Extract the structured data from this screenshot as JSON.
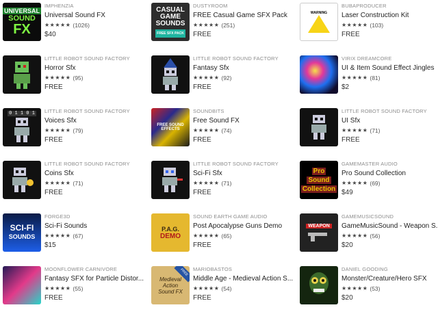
{
  "items": [
    {
      "publisher": "IMPHENZIA",
      "title": "Universal Sound FX",
      "stars": "★★★★★",
      "count": "(1026)",
      "price": "$40",
      "icon": "universal-sound-fx-icon"
    },
    {
      "publisher": "DUSTYROOM",
      "title": "FREE Casual Game SFX Pack",
      "stars": "★★★★★",
      "count": "(251)",
      "price": "FREE",
      "icon": "casual-game-sounds-icon"
    },
    {
      "publisher": "BUBAPRODUCER",
      "title": "Laser Construction Kit",
      "stars": "★★★★★",
      "count": "(103)",
      "price": "FREE",
      "icon": "laser-warning-icon"
    },
    {
      "publisher": "LITTLE ROBOT SOUND FACTORY",
      "title": "Horror Sfx",
      "stars": "★★★★★",
      "count": "(95)",
      "price": "FREE",
      "icon": "zombie-robot-icon"
    },
    {
      "publisher": "LITTLE ROBOT SOUND FACTORY",
      "title": "Fantasy Sfx",
      "stars": "★★★★★",
      "count": "(92)",
      "price": "FREE",
      "icon": "wizard-robot-icon"
    },
    {
      "publisher": "VIRIX DREAMCORE",
      "title": "UI & Item Sound Effect Jingles",
      "stars": "★★★★★",
      "count": "(81)",
      "price": "$2",
      "icon": "gems-icon"
    },
    {
      "publisher": "LITTLE ROBOT SOUND FACTORY",
      "title": "Voices Sfx",
      "stars": "★★★★★",
      "count": "(79)",
      "price": "FREE",
      "icon": "voice-robot-icon"
    },
    {
      "publisher": "SOUNDBITS",
      "title": "Free Sound FX",
      "stars": "★★★★★",
      "count": "(74)",
      "price": "FREE",
      "icon": "free-sound-effects-icon"
    },
    {
      "publisher": "LITTLE ROBOT SOUND FACTORY",
      "title": "UI Sfx",
      "stars": "★★★★★",
      "count": "(71)",
      "price": "FREE",
      "icon": "ui-robot-icon"
    },
    {
      "publisher": "LITTLE ROBOT SOUND FACTORY",
      "title": "Coins Sfx",
      "stars": "★★★★★",
      "count": "(71)",
      "price": "FREE",
      "icon": "coin-robot-icon"
    },
    {
      "publisher": "LITTLE ROBOT SOUND FACTORY",
      "title": "Sci-Fi Sfx",
      "stars": "★★★★★",
      "count": "(71)",
      "price": "FREE",
      "icon": "scifi-robot-icon"
    },
    {
      "publisher": "GAMEMASTER AUDIO",
      "title": "Pro Sound Collection",
      "stars": "★★★★★",
      "count": "(69)",
      "price": "$49",
      "icon": "pro-sound-collection-icon"
    },
    {
      "publisher": "FORGE3D",
      "title": "Sci-Fi Sounds",
      "stars": "★★★★★",
      "count": "(67)",
      "price": "$15",
      "icon": "scifi-sounds-icon"
    },
    {
      "publisher": "SOUND EARTH GAME AUDIO",
      "title": "Post Apocalypse Guns Demo",
      "stars": "★★★★★",
      "count": "(65)",
      "price": "FREE",
      "icon": "pag-demo-icon"
    },
    {
      "publisher": "GAMEMUSICSOUND",
      "title": "GameMusicSound - Weapon S...",
      "stars": "★★★★★",
      "count": "(56)",
      "price": "$20",
      "icon": "weapon-icon"
    },
    {
      "publisher": "MOONFLOWER CARNIVORE",
      "title": "Fantasy SFX for Particle Distor...",
      "stars": "★★★★★",
      "count": "(55)",
      "price": "FREE",
      "icon": "particle-fx-icon"
    },
    {
      "publisher": "MARIOBASTOS",
      "title": "Middle Age - Medieval Action S...",
      "stars": "★★★★★",
      "count": "(54)",
      "price": "FREE",
      "icon": "medieval-action-icon"
    },
    {
      "publisher": "DANIEL GOODING",
      "title": "Monster/Creature/Hero SFX",
      "stars": "★★★★★",
      "count": "(53)",
      "price": "$20",
      "icon": "monster-icon"
    }
  ],
  "art": {
    "universal": {
      "l1": "UNIVERSAL",
      "l2": "SOUND",
      "l3": "FX"
    },
    "casual": {
      "l1": "CASUAL",
      "l2": "GAME",
      "l3": "SOUNDS",
      "banner": "FREE SFX PACK"
    },
    "laser": {
      "warn": "WARNING"
    },
    "voices": {
      "code": "0 1 1 0 1"
    },
    "freesfx": {
      "label": "FREE SOUND EFFECTS"
    },
    "pro": {
      "l1": "Pro",
      "l2": "Sound",
      "l3": "Collection"
    },
    "scifi": {
      "l1": "SCI-FI",
      "l2": "SOUNDS"
    },
    "pag": {
      "l1": "P.A.G.",
      "l2": "DEMO"
    },
    "weapon": {
      "label": "WEAPON"
    },
    "medieval": {
      "l1": "Medieval",
      "l2": "Action",
      "l3": "Sound FX",
      "badge": "FREE"
    }
  }
}
